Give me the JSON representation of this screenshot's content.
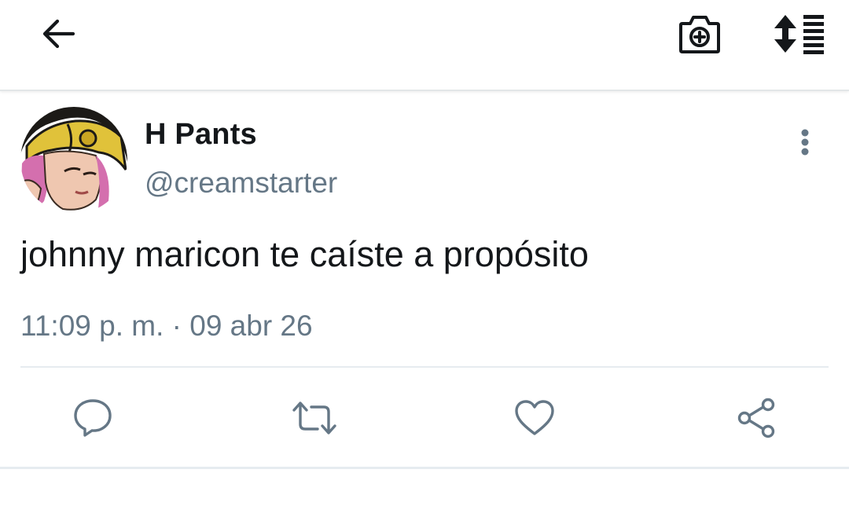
{
  "header": {
    "back_icon": "arrow-left-icon",
    "camera_icon": "camera-plus-icon",
    "sort_icon": "sort-list-icon"
  },
  "tweet": {
    "display_name": "H Pants",
    "handle": "@creamstarter",
    "text": "johnny maricon te caíste a propósito",
    "timestamp": "11:09 p. m. · 09 abr 26",
    "more_icon": "more-vertical-icon"
  },
  "actions": [
    {
      "icon": "reply-icon"
    },
    {
      "icon": "retweet-icon"
    },
    {
      "icon": "like-icon"
    },
    {
      "icon": "share-icon"
    }
  ],
  "colors": {
    "text_primary": "#14171a",
    "text_secondary": "#657786",
    "icon_action": "#657786",
    "divider": "#e6ecf0"
  }
}
